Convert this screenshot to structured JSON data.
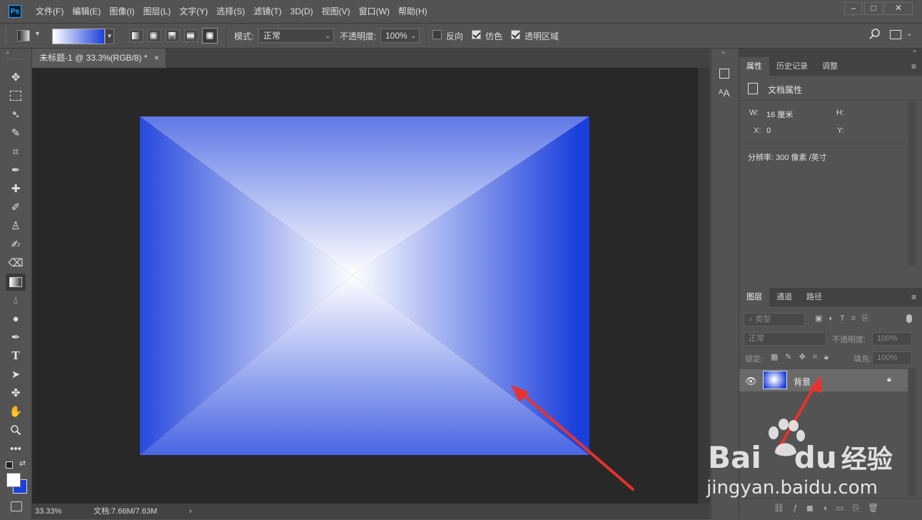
{
  "menubar": {
    "logo": "Ps",
    "items": [
      "文件(F)",
      "编辑(E)",
      "图像(I)",
      "图层(L)",
      "文字(Y)",
      "选择(S)",
      "滤镜(T)",
      "3D(D)",
      "视图(V)",
      "窗口(W)",
      "帮助(H)"
    ],
    "window_controls": [
      "–",
      "□",
      "✕"
    ]
  },
  "options": {
    "mode_label": "模式:",
    "mode_value": "正常",
    "opacity_label": "不透明度:",
    "opacity_value": "100%",
    "reverse_label": "反向",
    "dither_label": "仿色",
    "transparency_label": "透明区域",
    "reverse_checked": false,
    "dither_checked": true,
    "transparency_checked": true,
    "gradient_colors": [
      "#ffffff",
      "#1b3fdc"
    ]
  },
  "document": {
    "tab_title": "未标题-1 @ 33.3%(RGB/8) *",
    "tab_close": "×",
    "zoom": "33.33%",
    "doc_info": "文档:7.66M/7.63M",
    "status_arrow": "›"
  },
  "colors": {
    "foreground": "#ffffff",
    "background": "#1b3fdc",
    "gradient_edge": "#1b3fdc",
    "gradient_center": "#ffffff"
  },
  "properties": {
    "tabs": [
      "属性",
      "历史记录",
      "调整"
    ],
    "section_title": "文档属性",
    "w_label": "W:",
    "w_value": "16 厘米",
    "h_label": "H:",
    "x_label": "X:",
    "x_value": "0",
    "y_label": "Y:",
    "resolution": "分辨率: 300 像素 /英寸"
  },
  "layers": {
    "tabs": [
      "图层",
      "通道",
      "路径"
    ],
    "filter_placeholder": "类型",
    "blend_mode": "正常",
    "opacity_label": "不透明度:",
    "opacity_value": "100%",
    "lock_label": "锁定:",
    "fill_label": "填充:",
    "fill_value": "100%",
    "layer_name": "背景"
  },
  "watermark": {
    "brand": "Bai",
    "brand2": "du",
    "brand_cn": "经验",
    "url": "jingyan.baidu.com"
  }
}
